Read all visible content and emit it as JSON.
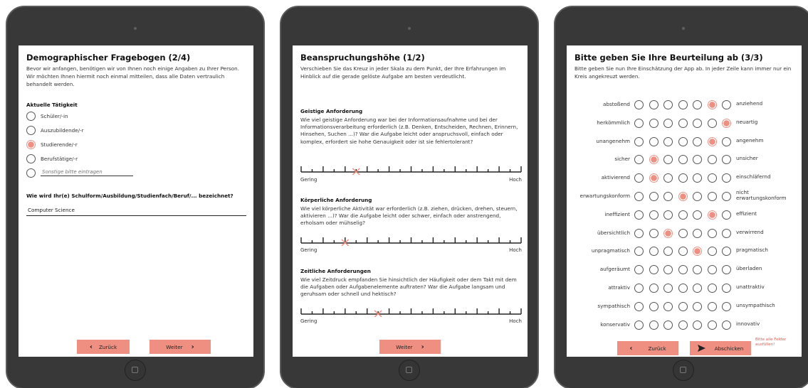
{
  "demographic": {
    "title": "Demographischer Fragebogen (2/4)",
    "intro": "Bevor wir anfangen, benötigen wir von Ihnen noch einige Angaben zu Ihrer Person. Wir möchten Ihnen hiermit noch einmal mitteilen, dass alle Daten vertraulich behandelt werden.",
    "activity_label": "Aktuelle Tätigkeit",
    "options": [
      {
        "label": "Schüler/-in",
        "selected": false
      },
      {
        "label": "Auszubildende/-r",
        "selected": false
      },
      {
        "label": "Studierende/-r",
        "selected": true
      },
      {
        "label": "Berufstätige/-r",
        "selected": false
      }
    ],
    "other_placeholder": "Sonstige bitte eintragen",
    "school_question": "Wie wird Ihr(e) Schulform/Ausbildung/Studienfach/Beruf/... bezeichnet?",
    "school_value": "Computer Science",
    "back_label": "Zurück",
    "next_label": "Weiter"
  },
  "workload": {
    "title": "Beanspruchungshöhe (1/2)",
    "intro": "Verschieben Sie das Kreuz in jeder Skala zu dem Punkt, der Ihre Erfahrungen im Hinblick auf die gerade gelöste Aufgabe am besten verdeutlicht.",
    "low_label": "Gering",
    "high_label": "Hoch",
    "sections": [
      {
        "title": "Geistige Anforderung",
        "text": "Wie viel geistige Anforderung war bei der Informationsaufnahme und bei der Informationsverarbeitung erforderlich (z.B. Denken, Entscheiden, Rechnen, Erinnern, Hinsehen, Suchen ...)? War die Aufgabe leicht oder anspruchsvoll, einfach oder komplex, erfordert sie hohe Genauigkeit oder ist sie fehlertolerant?",
        "value": 0.25
      },
      {
        "title": "Körperliche Anforderung",
        "text": "Wie viel körperliche Aktivität war erforderlich (z.B. ziehen, drücken, drehen, steuern, aktivieren ...)? War die Aufgabe leicht oder schwer, einfach oder anstrengend, erholsam oder mühselig?",
        "value": 0.2
      },
      {
        "title": "Zeitliche Anforderungen",
        "text": "Wie viel Zeitdruck empfanden Sie hinsichtlich der Häufigkeit oder dem Takt mit dem die Aufgaben oder Aufgabenelemente auftraten? War die Aufgabe langsam und geruhsam oder schnell und hektisch?",
        "value": 0.35
      }
    ],
    "next_label": "Weiter"
  },
  "rating": {
    "title": "Bitte geben Sie Ihre Beurteilung ab (3/3)",
    "intro": "Bitte geben Sie nun Ihre Einschätzung der App ab. In jeder Zeile kann immer nur ein Kreis angekreuzt werden.",
    "rows": [
      {
        "left": "abstoßend",
        "right": "anziehend",
        "selected": 6
      },
      {
        "left": "herkömmlich",
        "right": "neuartig",
        "selected": 7
      },
      {
        "left": "unangenehm",
        "right": "angenehm",
        "selected": 6
      },
      {
        "left": "sicher",
        "right": "unsicher",
        "selected": 2
      },
      {
        "left": "aktivierend",
        "right": "einschläfernd",
        "selected": 2
      },
      {
        "left": "erwartungskonform",
        "right": "nicht erwartungskonform",
        "selected": 4
      },
      {
        "left": "ineffizient",
        "right": "effizient",
        "selected": 6
      },
      {
        "left": "übersichtlich",
        "right": "verwirrend",
        "selected": 3
      },
      {
        "left": "unpragmatisch",
        "right": "pragmatisch",
        "selected": 5
      },
      {
        "left": "aufgeräumt",
        "right": "überladen",
        "selected": 0
      },
      {
        "left": "attraktiv",
        "right": "unattraktiv",
        "selected": 0
      },
      {
        "left": "sympathisch",
        "right": "unsympathisch",
        "selected": 0
      },
      {
        "left": "konservativ",
        "right": "innovativ",
        "selected": 0
      }
    ],
    "back_label": "Zurück",
    "submit_label": "Abschicken",
    "warning": "Bitte alle Felder ausfüllen!"
  },
  "colors": {
    "accent": "#ee8f82",
    "device": "#383838",
    "warning": "#e05a4a"
  }
}
